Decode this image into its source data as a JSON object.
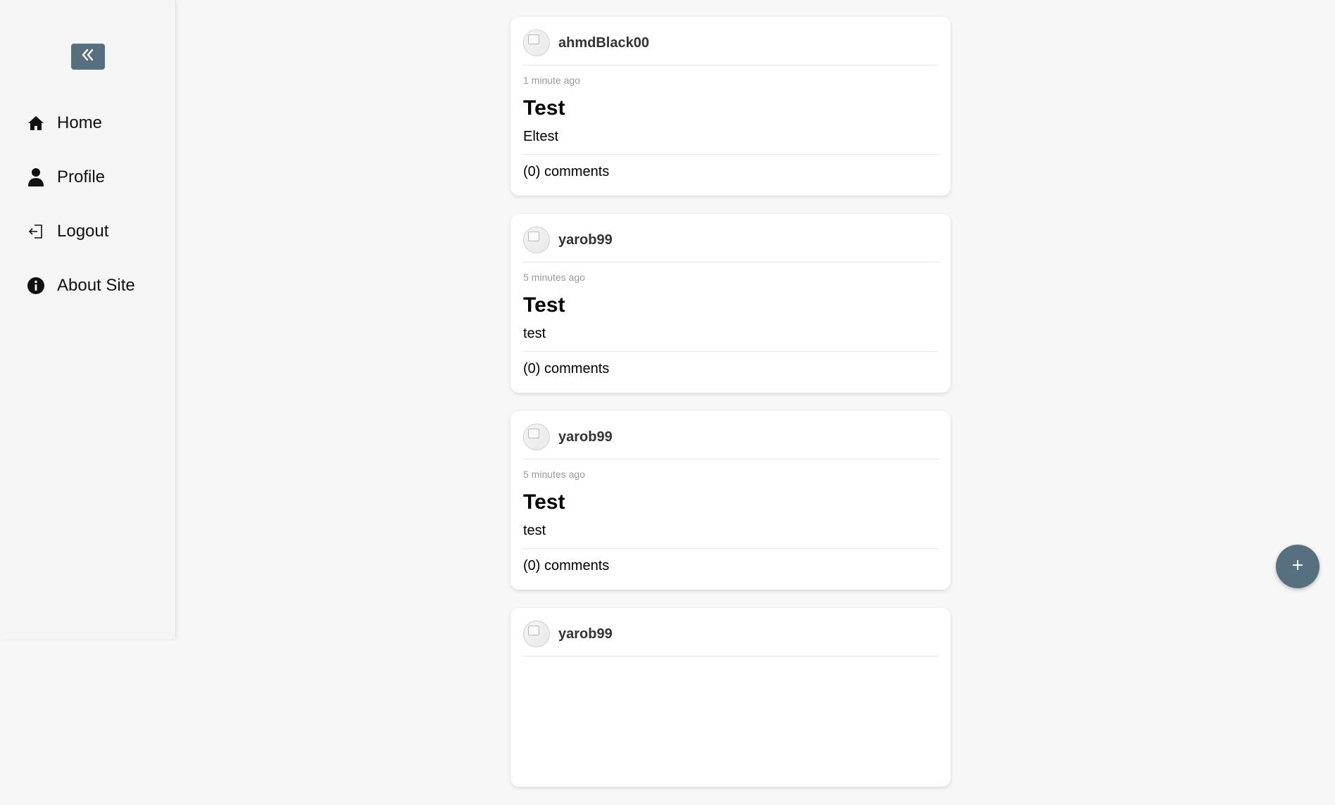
{
  "sidebar": {
    "collapse_icon": "double-chevron-left-icon",
    "items": [
      {
        "label": "Home",
        "icon": "home-icon"
      },
      {
        "label": "Profile",
        "icon": "user-icon"
      },
      {
        "label": "Logout",
        "icon": "logout-icon"
      },
      {
        "label": "About Site",
        "icon": "info-icon"
      }
    ]
  },
  "posts": [
    {
      "username": "ahmdBlack00",
      "time": "1 minute ago",
      "title": "Test",
      "body": "Eltest",
      "comments": "(0) comments"
    },
    {
      "username": "yarob99",
      "time": "5 minutes ago",
      "title": "Test",
      "body": "test",
      "comments": "(0) comments"
    },
    {
      "username": "yarob99",
      "time": "5 minutes ago",
      "title": "Test",
      "body": "test",
      "comments": "(0) comments"
    },
    {
      "username": "yarob99"
    }
  ],
  "fab": {
    "icon": "plus-icon"
  },
  "colors": {
    "accent": "#56707f",
    "background": "#f7f7f7",
    "card": "#ffffff"
  }
}
